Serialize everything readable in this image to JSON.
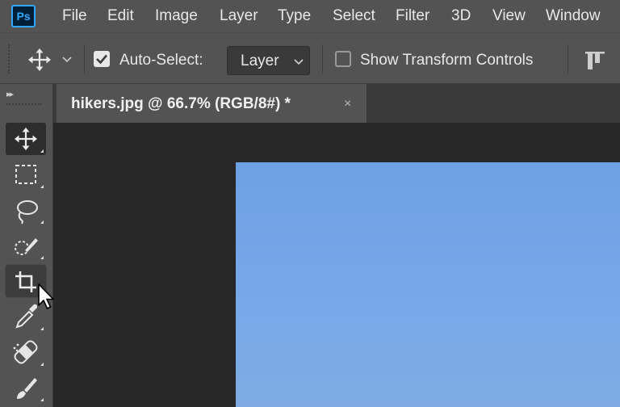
{
  "app": {
    "logo_text": "Ps"
  },
  "menu": {
    "items": [
      {
        "id": "file",
        "label": "File"
      },
      {
        "id": "edit",
        "label": "Edit"
      },
      {
        "id": "image",
        "label": "Image"
      },
      {
        "id": "layer",
        "label": "Layer"
      },
      {
        "id": "type",
        "label": "Type"
      },
      {
        "id": "select",
        "label": "Select"
      },
      {
        "id": "filter",
        "label": "Filter"
      },
      {
        "id": "3d",
        "label": "3D"
      },
      {
        "id": "view",
        "label": "View"
      },
      {
        "id": "window",
        "label": "Window"
      }
    ]
  },
  "options": {
    "auto_select_label": "Auto-Select:",
    "auto_select_checked": true,
    "auto_select_target": "Layer",
    "show_transform_label": "Show Transform Controls",
    "show_transform_checked": false
  },
  "toolbar": {
    "collapse_icon": "double-chevron-right-icon",
    "tools": [
      {
        "id": "move",
        "icon": "move-icon",
        "state": "active"
      },
      {
        "id": "marquee",
        "icon": "rectangular-marquee-icon",
        "state": "normal"
      },
      {
        "id": "lasso",
        "icon": "lasso-icon",
        "state": "normal"
      },
      {
        "id": "quick-select",
        "icon": "quick-selection-icon",
        "state": "normal"
      },
      {
        "id": "crop",
        "icon": "crop-icon",
        "state": "hover"
      },
      {
        "id": "eyedropper",
        "icon": "eyedropper-icon",
        "state": "normal"
      },
      {
        "id": "healing",
        "icon": "spot-healing-brush-icon",
        "state": "normal"
      },
      {
        "id": "brush",
        "icon": "brush-icon",
        "state": "normal"
      }
    ]
  },
  "document": {
    "tab_title": "hikers.jpg @ 66.7% (RGB/8#) *",
    "close_glyph": "×"
  },
  "colors": {
    "chrome": "#535353",
    "canvas_bg": "#282828",
    "sky_top": "#6ea0e4",
    "sky_bottom": "#7fabe2",
    "ps_blue": "#31a8ff"
  }
}
